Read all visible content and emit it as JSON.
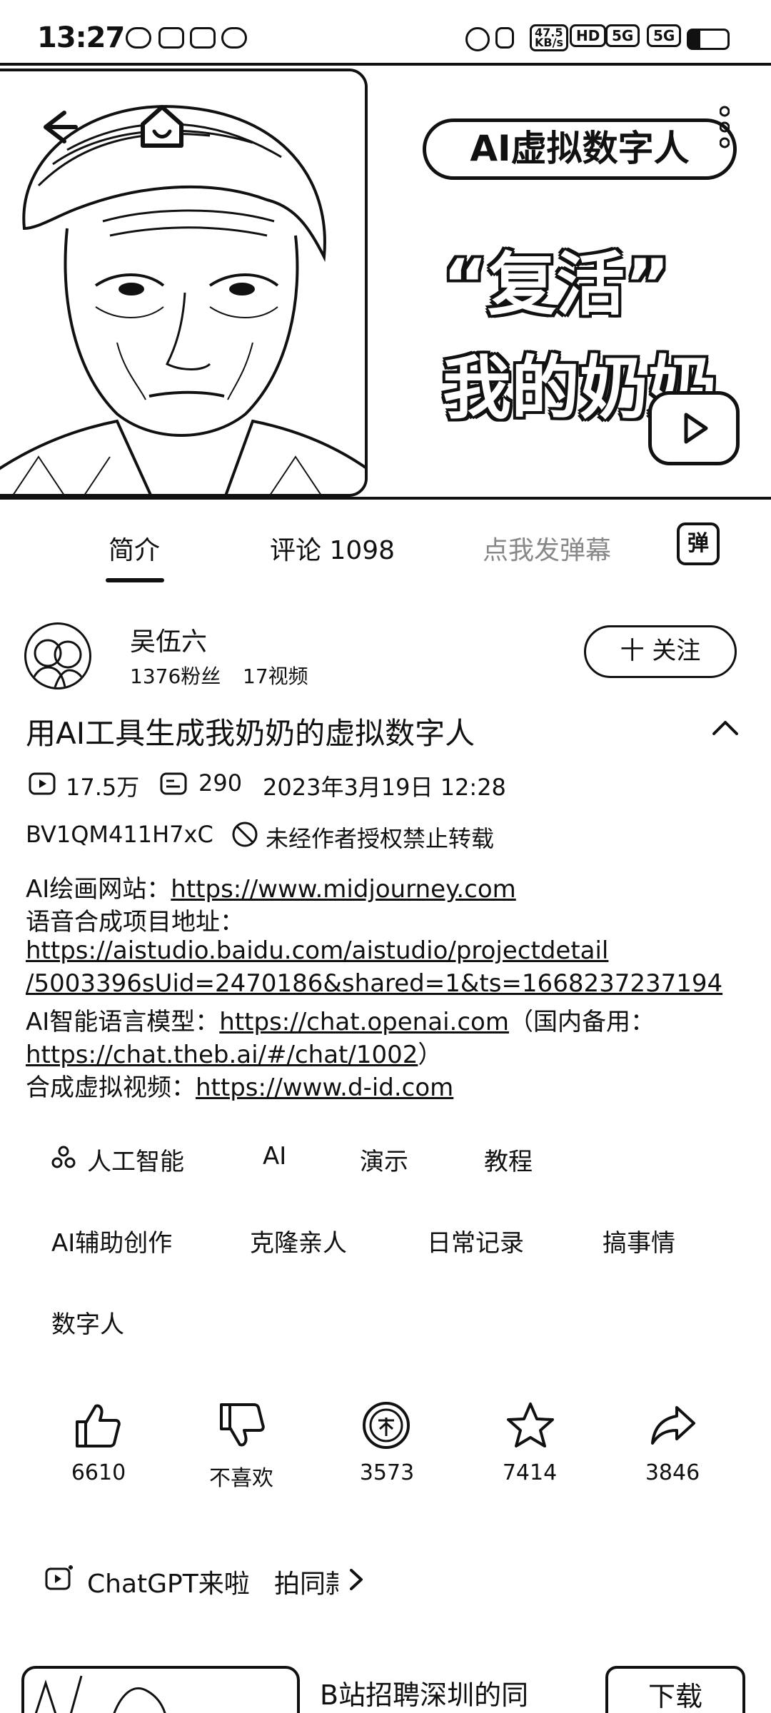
{
  "status_bar": {
    "time": "13:27",
    "net_speed_top": "47.5",
    "net_speed_unit": "KB/s",
    "hd": "HD",
    "signal1": "5G",
    "signal2": "5G"
  },
  "video": {
    "pill_text": "AI虚拟数字人",
    "headline_line1": "“复活”",
    "headline_line2": "我的奶奶"
  },
  "tabs": {
    "intro": "简介",
    "comments": "评论 1098",
    "danmaku_placeholder": "点我发弹幕",
    "danmaku_icon_label": "弹"
  },
  "author": {
    "name": "吴伍六",
    "fans": "1376粉丝",
    "videos": "17视频",
    "follow_label": "十 关注"
  },
  "video_info": {
    "title": "用AI工具生成我奶奶的虚拟数字人",
    "views": "17.5万",
    "danmaku_count": "290",
    "date": "2023年3月19日 12:28",
    "bvid": "BV1QM411H7xC",
    "copyright": "未经作者授权禁止转载"
  },
  "description": {
    "line1_label": "AI绘画网站：",
    "line1_link": "https://www.midjourney.com",
    "line2_label": "语音合成项目地址：",
    "line3_link": "https://aistudio.baidu.com/aistudio/projectdetail",
    "line4_link": "/5003396sUid=2470186&shared=1&ts=1668237237194",
    "line5_label": "AI智能语言模型：",
    "line5_link": "https://chat.openai.com",
    "line5_suffix": "（国内备用：",
    "line6_link": "https://chat.theb.ai/#/chat/1002",
    "line6_suffix": "）",
    "line7_label": "合成虚拟视频：",
    "line7_link": "https://www.d-id.com"
  },
  "tags": [
    "人工智能",
    "AI",
    "演示",
    "教程",
    "AI辅助创作",
    "克隆亲人",
    "日常记录",
    "搞事情",
    "数字人"
  ],
  "actions": {
    "like": "6610",
    "dislike": "不喜欢",
    "coin": "3573",
    "favorite": "7414",
    "share": "3846"
  },
  "recommend": {
    "topic": "ChatGPT来啦",
    "same_style": "拍同款",
    "card_title": "B站招聘深圳的同",
    "download_label": "下载"
  }
}
